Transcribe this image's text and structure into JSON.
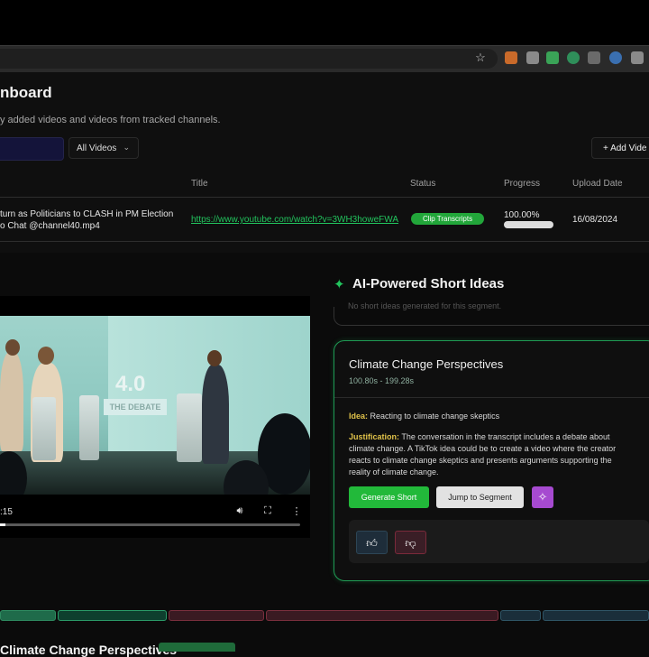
{
  "browser": {
    "star_icon": "star-icon",
    "extension_colors": [
      "#c96a2a",
      "#8a8a8a",
      "#3aa357",
      "#2f8f5a",
      "#6a6a6a",
      "#3a6fb0",
      "#8a8a8a",
      "#9a9a9a"
    ]
  },
  "dashboard": {
    "title": "nboard",
    "subtitle": "y added videos and videos from tracked channels.",
    "filter_selected": "All Videos",
    "add_button_label": "+  Add Vide",
    "columns": [
      "Title",
      "Status",
      "Progress",
      "Upload Date"
    ],
    "row": {
      "name_line1": "turn as Politicians to CLASH in PM Election",
      "name_line2": "o Chat @channel40.mp4",
      "url": "https://www.youtube.com/watch?v=3WH3howeFWA",
      "status": "Clip Transcripts",
      "progress_text": "100.00%",
      "progress_value": 1.0,
      "upload_date": "16/08/2024"
    }
  },
  "video": {
    "time": ":15",
    "logo_number": "4.0",
    "logo_text": "THE DEBATE",
    "progress_fraction": 0.02
  },
  "ideas": {
    "header": "AI-Powered Short Ideas",
    "previous_card_text": "No short ideas generated for this segment.",
    "card": {
      "title": "Climate Change Perspectives",
      "range": "100.80s - 199.28s",
      "idea_label": "Idea:",
      "idea_text": "Reacting to climate change skeptics",
      "justification_label": "Justification:",
      "justification_text": "The conversation in the transcript includes a debate about climate change. A TikTok idea could be to create a video where the creator reacts to climate change skeptics and presents arguments supporting the reality of climate change.",
      "generate_label": "Generate Short",
      "jump_label": "Jump to Segment"
    }
  },
  "timeline": {
    "segment_colors": [
      "#1f6b4a",
      "#0e3f2e",
      "#3a1a22",
      "#3a1a22",
      "#1a2e3a",
      "#1a2e3a",
      "#1a2e3a"
    ]
  },
  "bottom": {
    "title": "Climate Change Perspectives"
  }
}
